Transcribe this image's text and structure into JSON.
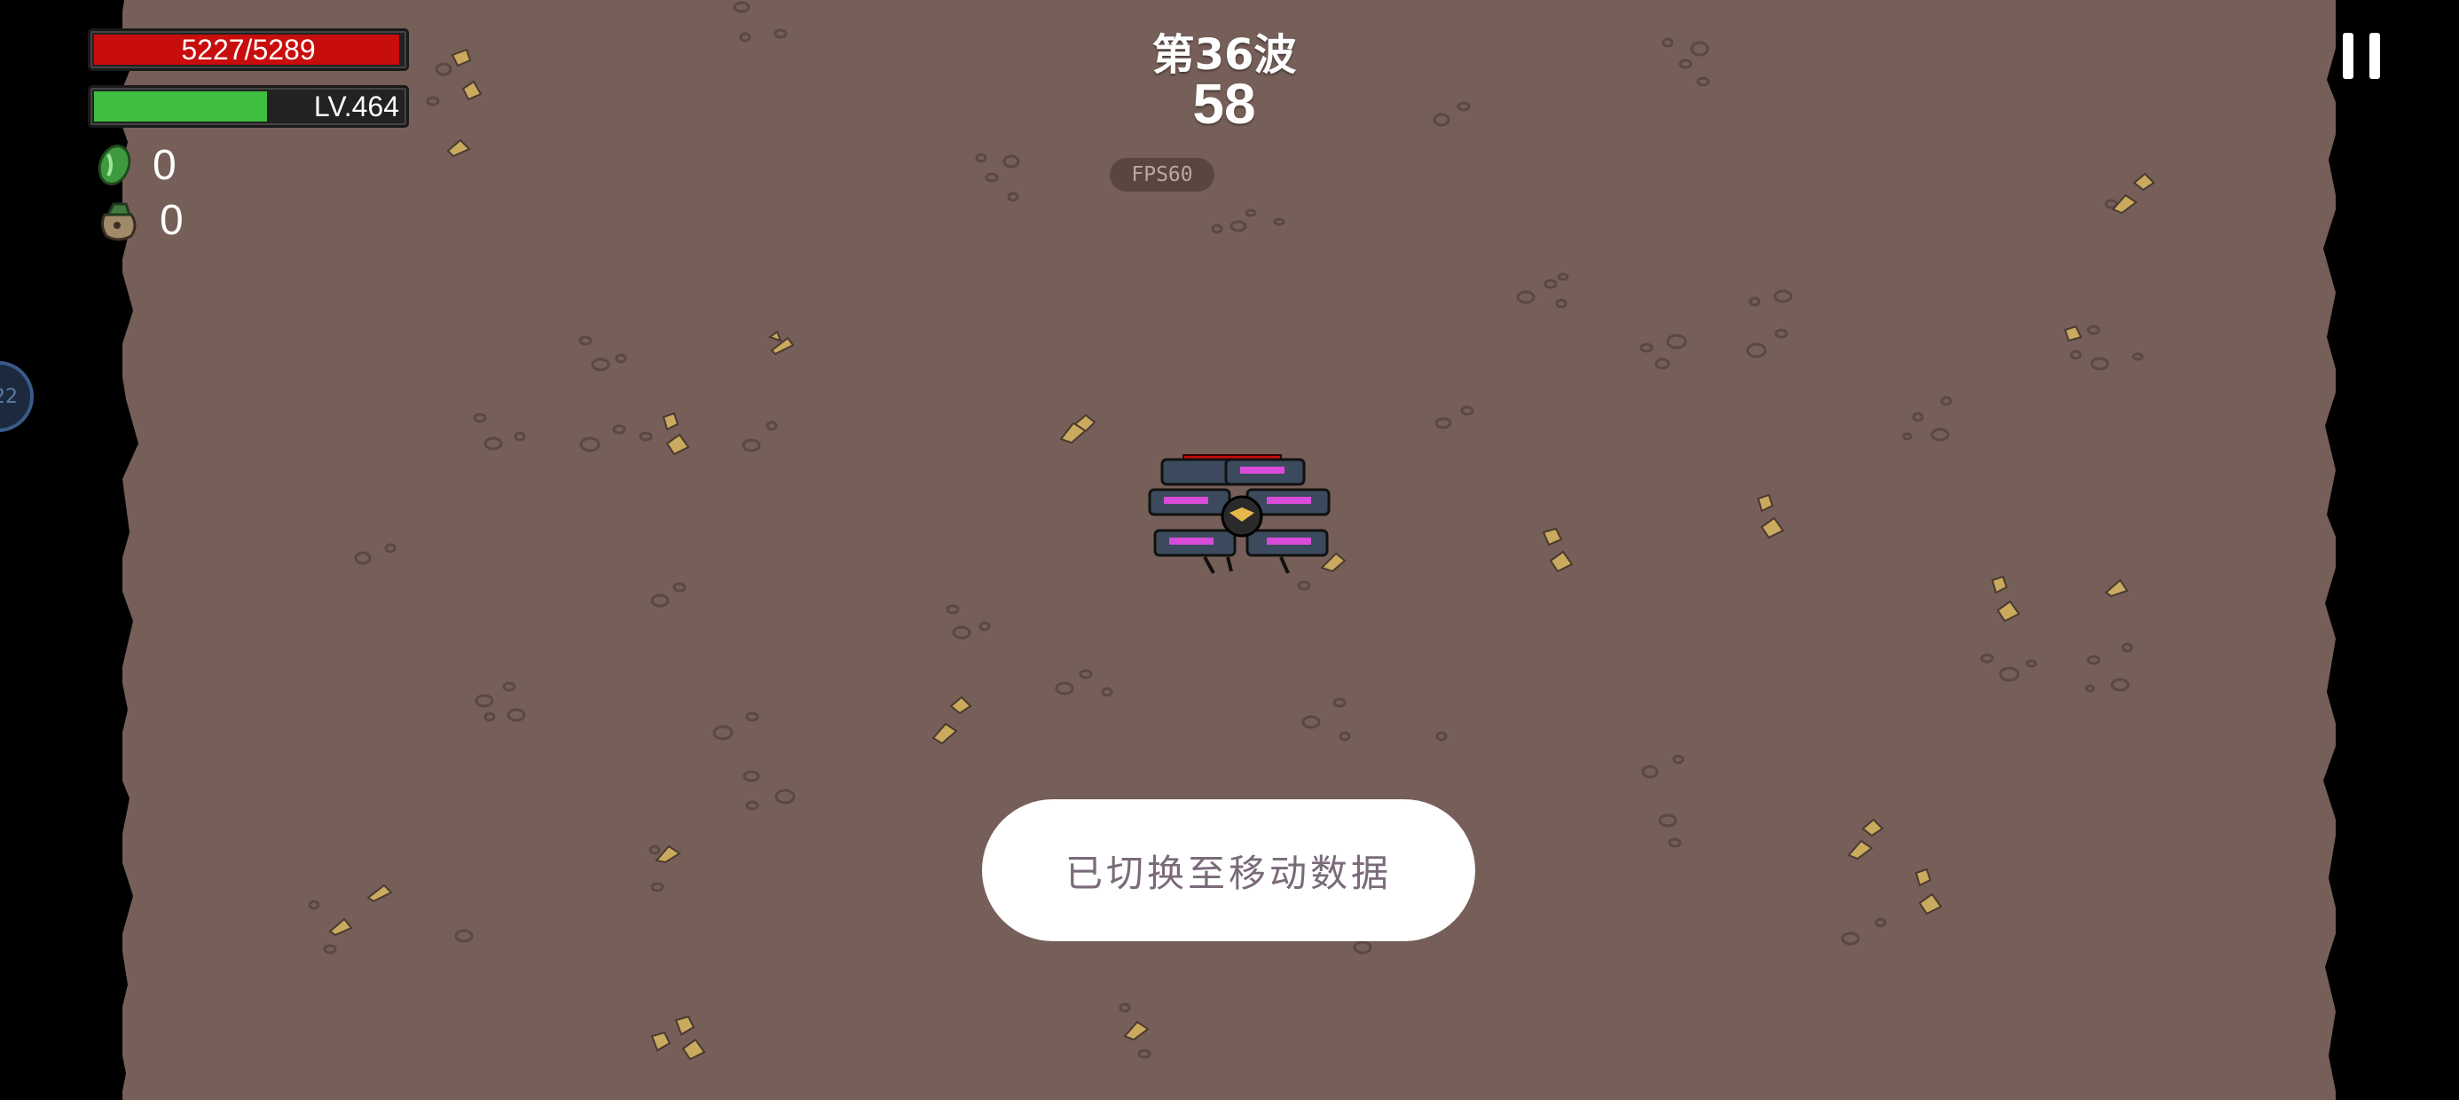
{
  "hud": {
    "hp_text": "5227/5289",
    "hp_fraction": 0.988,
    "hp_color": "#c80d0d",
    "level_text": "LV.464",
    "xp_fraction": 0.56,
    "xp_color": "#3fbf3f",
    "materials_count": "0",
    "bags_count": "0"
  },
  "wave": {
    "title": "第36波",
    "timer": "58"
  },
  "fps": "FPS60",
  "side_tab_text": "22",
  "toast": "已切换至移动数据",
  "colors": {
    "ground": "#765f58",
    "void": "#000000"
  }
}
